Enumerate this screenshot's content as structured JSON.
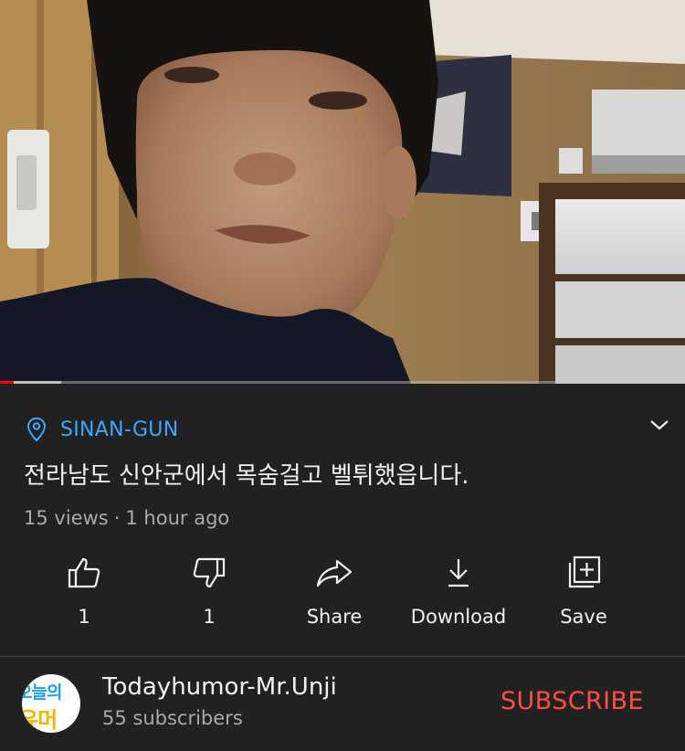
{
  "video": {
    "progress_fraction": 0.02,
    "buffer_fraction": 0.09
  },
  "location": {
    "text": "SINAN-GUN",
    "icon": "location-pin-icon"
  },
  "title": "전라남도 신안군에서 목숨걸고 벨튀했읍니다.",
  "meta": {
    "views": "15 views",
    "separator": "·",
    "time": "1 hour ago"
  },
  "actions": [
    {
      "id": "like",
      "icon": "thumbs-up-icon",
      "label": "1"
    },
    {
      "id": "dislike",
      "icon": "thumbs-down-icon",
      "label": "1"
    },
    {
      "id": "share",
      "icon": "share-arrow-icon",
      "label": "Share"
    },
    {
      "id": "download",
      "icon": "download-icon",
      "label": "Download"
    },
    {
      "id": "save",
      "icon": "add-to-playlist-icon",
      "label": "Save"
    }
  ],
  "channel": {
    "avatar_text_top": "오늘의",
    "avatar_text_bottom": "유머",
    "name": "Todayhumor-Mr.Unji",
    "subscribers": "55 subscribers",
    "subscribe_label": "SUBSCRIBE"
  },
  "colors": {
    "background": "#212121",
    "location_blue": "#3ea6ff",
    "subscribe_red": "#ff4e45",
    "progress_red": "#ff0000",
    "secondary_text": "#aaaaaa"
  }
}
